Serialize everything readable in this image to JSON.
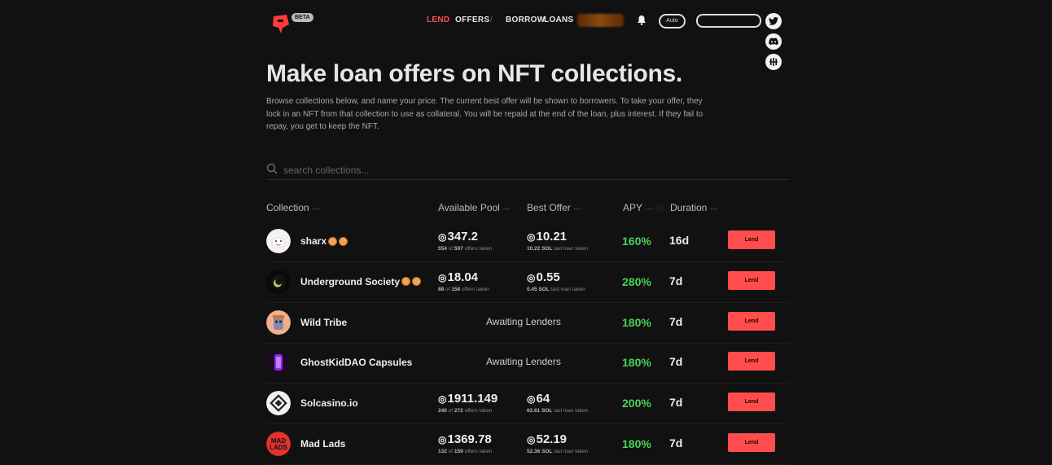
{
  "nav": {
    "beta": "BETA",
    "lend": "LEND",
    "offers": "OFFERS",
    "separator": "/",
    "borrow": "BORROW",
    "loans": "LOANS",
    "auto": "Auto"
  },
  "social": [
    "twitter-icon",
    "discord-icon",
    "medium-icon"
  ],
  "header": {
    "title": "Make loan offers on NFT collections.",
    "description": "Browse collections below, and name your price. The current best offer will be shown to borrowers. To take your offer, they lock in an NFT from that collection to use as collateral. You will be repaid at the end of the loan, plus interest. If they fail to repay, you get to keep the NFT."
  },
  "search": {
    "placeholder": "search collections..."
  },
  "columns": {
    "collection": "Collection",
    "pool": "Available Pool",
    "offer": "Best Offer",
    "apy": "APY",
    "duration": "Duration"
  },
  "sol_symbol": "◎",
  "lend_label": "Lend",
  "colors": {
    "accent": "#ff4d4d",
    "apy": "#4cd15c",
    "background": "#111111"
  },
  "rows": [
    {
      "name": "sharx",
      "badges": 2,
      "pool": "347.2",
      "taken": "554",
      "total": "597",
      "offers_label": "offers taken",
      "best": "10.21",
      "last_loan": "10.22 SOL",
      "last_label": "last loan taken",
      "awaiting": "",
      "apy": "160%",
      "duration": "16d",
      "avatar": "sharx"
    },
    {
      "name": "Underground Society",
      "badges": 2,
      "pool": "18.04",
      "taken": "88",
      "total": "158",
      "offers_label": "offers taken",
      "best": "0.55",
      "last_loan": "0.45 SOL",
      "last_label": "last loan taken",
      "awaiting": "",
      "apy": "280%",
      "duration": "7d",
      "avatar": "underground"
    },
    {
      "name": "Wild Tribe",
      "badges": 0,
      "pool": "",
      "taken": "",
      "total": "",
      "offers_label": "",
      "best": "",
      "last_loan": "",
      "last_label": "",
      "awaiting": "Awaiting Lenders",
      "apy": "180%",
      "duration": "7d",
      "avatar": "wildtribe"
    },
    {
      "name": "GhostKidDAO Capsules",
      "badges": 0,
      "pool": "",
      "taken": "",
      "total": "",
      "offers_label": "",
      "best": "",
      "last_loan": "",
      "last_label": "",
      "awaiting": "Awaiting Lenders",
      "apy": "180%",
      "duration": "7d",
      "avatar": "ghostkid"
    },
    {
      "name": "Solcasino.io",
      "badges": 0,
      "pool": "1911.149",
      "taken": "240",
      "total": "272",
      "offers_label": "offers taken",
      "best": "64",
      "last_loan": "62.61 SOL",
      "last_label": "last loan taken",
      "awaiting": "",
      "apy": "200%",
      "duration": "7d",
      "avatar": "solcasino"
    },
    {
      "name": "Mad Lads",
      "badges": 0,
      "pool": "1369.78",
      "taken": "132",
      "total": "159",
      "offers_label": "offers taken",
      "best": "52.19",
      "last_loan": "52.36 SOL",
      "last_label": "last loan taken",
      "awaiting": "",
      "apy": "180%",
      "duration": "7d",
      "avatar": "madlads"
    }
  ]
}
